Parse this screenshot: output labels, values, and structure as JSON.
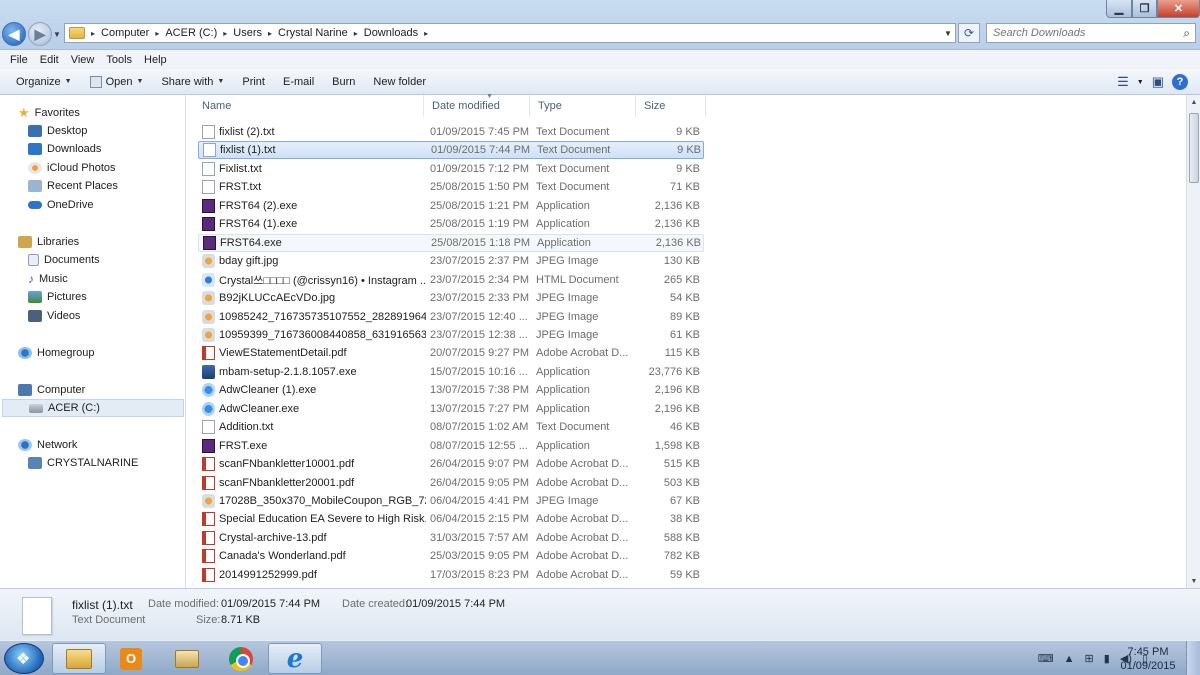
{
  "window": {
    "min_symbol": "▁",
    "max_symbol": "❐",
    "close_symbol": "✕"
  },
  "address": {
    "crumbs": [
      "Computer",
      "ACER (C:)",
      "Users",
      "Crystal Narine",
      "Downloads"
    ],
    "separator": "▸"
  },
  "search": {
    "placeholder": "Search Downloads"
  },
  "menu": [
    "File",
    "Edit",
    "View",
    "Tools",
    "Help"
  ],
  "commands": {
    "organize": "Organize",
    "open": "Open",
    "share_with": "Share with",
    "print": "Print",
    "email": "E-mail",
    "burn": "Burn",
    "new_folder": "New folder"
  },
  "nav": {
    "favorites": "Favorites",
    "desktop": "Desktop",
    "downloads": "Downloads",
    "icloud": "iCloud Photos",
    "recent": "Recent Places",
    "onedrive": "OneDrive",
    "libraries": "Libraries",
    "documents": "Documents",
    "music": "Music",
    "pictures": "Pictures",
    "videos": "Videos",
    "homegroup": "Homegroup",
    "computer": "Computer",
    "acer": "ACER (C:)",
    "network": "Network",
    "crystalnarine": "CRYSTALNARINE"
  },
  "columns": {
    "name": "Name",
    "date": "Date modified",
    "type": "Type",
    "size": "Size"
  },
  "files": [
    {
      "name": "fixlist (2).txt",
      "date": "01/09/2015 7:45 PM",
      "type": "Text Document",
      "size": "9 KB",
      "icon": "txt"
    },
    {
      "name": "fixlist (1).txt",
      "date": "01/09/2015 7:44 PM",
      "type": "Text Document",
      "size": "9 KB",
      "icon": "txt"
    },
    {
      "name": "Fixlist.txt",
      "date": "01/09/2015 7:12 PM",
      "type": "Text Document",
      "size": "9 KB",
      "icon": "txt"
    },
    {
      "name": "FRST.txt",
      "date": "25/08/2015 1:50 PM",
      "type": "Text Document",
      "size": "71 KB",
      "icon": "txt"
    },
    {
      "name": "FRST64 (2).exe",
      "date": "25/08/2015 1:21 PM",
      "type": "Application",
      "size": "2,136 KB",
      "icon": "exe"
    },
    {
      "name": "FRST64 (1).exe",
      "date": "25/08/2015 1:19 PM",
      "type": "Application",
      "size": "2,136 KB",
      "icon": "exe"
    },
    {
      "name": "FRST64.exe",
      "date": "25/08/2015 1:18 PM",
      "type": "Application",
      "size": "2,136 KB",
      "icon": "exe"
    },
    {
      "name": "bday gift.jpg",
      "date": "23/07/2015 2:37 PM",
      "type": "JPEG Image",
      "size": "130 KB",
      "icon": "jpg"
    },
    {
      "name": "Crystal쓰□□□□ (@crissyn16) • Instagram ...",
      "date": "23/07/2015 2:34 PM",
      "type": "HTML Document",
      "size": "265 KB",
      "icon": "html"
    },
    {
      "name": "B92jKLUCcAEcVDo.jpg",
      "date": "23/07/2015 2:33 PM",
      "type": "JPEG Image",
      "size": "54 KB",
      "icon": "jpg"
    },
    {
      "name": "10985242_716735735107552_28289196435...",
      "date": "23/07/2015 12:40 ...",
      "type": "JPEG Image",
      "size": "89 KB",
      "icon": "jpg"
    },
    {
      "name": "10959399_716736008440858_63191656326...",
      "date": "23/07/2015 12:38 ...",
      "type": "JPEG Image",
      "size": "61 KB",
      "icon": "jpg"
    },
    {
      "name": "ViewEStatementDetail.pdf",
      "date": "20/07/2015 9:27 PM",
      "type": "Adobe Acrobat D...",
      "size": "115 KB",
      "icon": "pdf"
    },
    {
      "name": "mbam-setup-2.1.8.1057.exe",
      "date": "15/07/2015 10:16 ...",
      "type": "Application",
      "size": "23,776 KB",
      "icon": "mbam"
    },
    {
      "name": "AdwCleaner (1).exe",
      "date": "13/07/2015 7:38 PM",
      "type": "Application",
      "size": "2,196 KB",
      "icon": "adw"
    },
    {
      "name": "AdwCleaner.exe",
      "date": "13/07/2015 7:27 PM",
      "type": "Application",
      "size": "2,196 KB",
      "icon": "adw"
    },
    {
      "name": "Addition.txt",
      "date": "08/07/2015 1:02 AM",
      "type": "Text Document",
      "size": "46 KB",
      "icon": "txt"
    },
    {
      "name": "FRST.exe",
      "date": "08/07/2015 12:55 ...",
      "type": "Application",
      "size": "1,598 KB",
      "icon": "exe"
    },
    {
      "name": "scanFNbankletter10001.pdf",
      "date": "26/04/2015 9:07 PM",
      "type": "Adobe Acrobat D...",
      "size": "515 KB",
      "icon": "pdf"
    },
    {
      "name": "scanFNbankletter20001.pdf",
      "date": "26/04/2015 9:05 PM",
      "type": "Adobe Acrobat D...",
      "size": "503 KB",
      "icon": "pdf"
    },
    {
      "name": "17028B_350x370_MobileCoupon_RGB_72...",
      "date": "06/04/2015 4:41 PM",
      "type": "JPEG Image",
      "size": "67 KB",
      "icon": "jpg"
    },
    {
      "name": "Special Education EA Severe to High Risk...",
      "date": "06/04/2015 2:15 PM",
      "type": "Adobe Acrobat D...",
      "size": "38 KB",
      "icon": "pdf"
    },
    {
      "name": "Crystal-archive-13.pdf",
      "date": "31/03/2015 7:57 AM",
      "type": "Adobe Acrobat D...",
      "size": "588 KB",
      "icon": "pdf"
    },
    {
      "name": "Canada's Wonderland.pdf",
      "date": "25/03/2015 9:05 PM",
      "type": "Adobe Acrobat D...",
      "size": "782 KB",
      "icon": "pdf"
    },
    {
      "name": "2014991252999.pdf",
      "date": "17/03/2015 8:23 PM",
      "type": "Adobe Acrobat D...",
      "size": "59 KB",
      "icon": "pdf"
    }
  ],
  "selected_index": 1,
  "hovered_index": 6,
  "details": {
    "name": "fixlist (1).txt",
    "type": "Text Document",
    "date_modified_label": "Date modified:",
    "date_modified": "01/09/2015 7:44 PM",
    "date_created_label": "Date created:",
    "date_created": "01/09/2015 7:44 PM",
    "size_label": "Size:",
    "size": "8.71 KB"
  },
  "taskbar": {
    "outlook_letter": "O",
    "ie_letter": "e",
    "time": "7:45 PM",
    "date": "01/09/2015"
  }
}
